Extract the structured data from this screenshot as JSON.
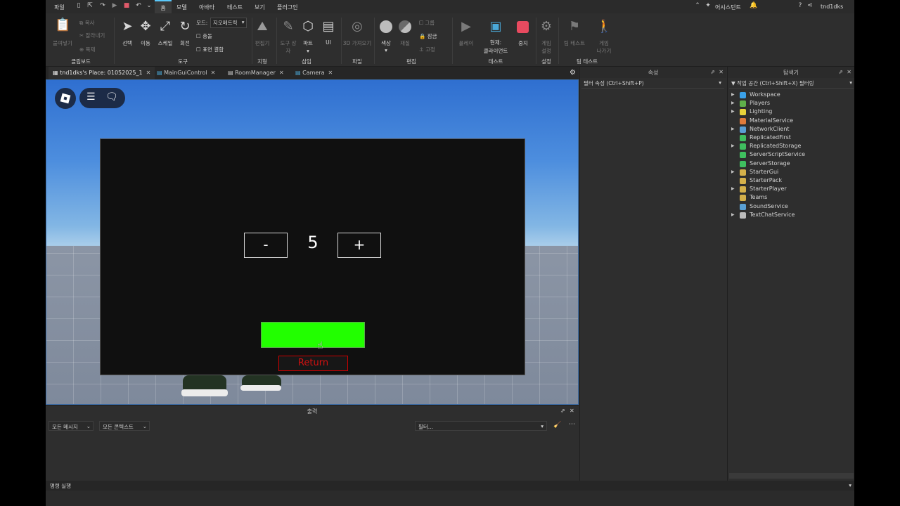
{
  "menubar": {
    "file": "파일",
    "home": "홈",
    "model": "모델",
    "avatar": "아바타",
    "test": "테스트",
    "view": "보기",
    "plugins": "플러그인",
    "assistant": "어시스턴트",
    "user": "tnd1dks"
  },
  "ribbon": {
    "clipboard": {
      "paste": "붙여넣기",
      "copy": "복사",
      "cut": "잘라내기",
      "duplicate": "복제",
      "group": "클립보드"
    },
    "tools": {
      "select": "선택",
      "move": "이동",
      "scale": "스케일",
      "rotate": "회전",
      "mode_label": "모드:",
      "mode_value": "지오메트릭",
      "collisions": "충돌",
      "join_surfaces": "표면 결합",
      "group": "도구"
    },
    "terrain": {
      "editor": "편집기",
      "group": "지형"
    },
    "insert": {
      "toolbox": "도구 상자",
      "part": "파트",
      "ui": "UI",
      "group": "삽입"
    },
    "file": {
      "import3d": "3D 가져오기",
      "group": "파일"
    },
    "edit": {
      "color": "색상",
      "material": "재질",
      "group_btn": "그룹",
      "lock": "잠금",
      "anchor": "고정",
      "group": "편집"
    },
    "test": {
      "play": "플레이",
      "current": "현재:",
      "client": "클라이언트",
      "stop": "중지",
      "group": "테스트"
    },
    "settings": {
      "game_settings": "게임 설정",
      "group": "설정"
    },
    "team_test": {
      "team_test": "팀 테스트",
      "exit_game": "게임 나가기",
      "group": "팀 테스트"
    }
  },
  "tabs": [
    {
      "label": "tnd1dks's Place: 01052025_1"
    },
    {
      "label": "MainGuiControl"
    },
    {
      "label": "RoomManager"
    },
    {
      "label": "Camera"
    }
  ],
  "game": {
    "minus": "-",
    "count": "5",
    "plus": "+",
    "return": "Return"
  },
  "output": {
    "title": "출력",
    "all_messages": "모든 메시지",
    "all_contexts": "모든 콘텍스트",
    "filter_placeholder": "필터..."
  },
  "command_bar": {
    "label": "명령 실행"
  },
  "properties": {
    "title": "속성",
    "filter": "필터 속성 (Ctrl+Shift+P)"
  },
  "explorer": {
    "title": "탐색기",
    "filter": "작업 공간 (Ctrl+Shift+X) 필터링",
    "items": [
      {
        "label": "Workspace",
        "color": "#3aa0e8",
        "expandable": true
      },
      {
        "label": "Players",
        "color": "#5fb04a",
        "expandable": true
      },
      {
        "label": "Lighting",
        "color": "#e8d23a",
        "expandable": true
      },
      {
        "label": "MaterialService",
        "color": "#e07b3a",
        "expandable": false
      },
      {
        "label": "NetworkClient",
        "color": "#5a9fd4",
        "expandable": true
      },
      {
        "label": "ReplicatedFirst",
        "color": "#3fbf5f",
        "expandable": false
      },
      {
        "label": "ReplicatedStorage",
        "color": "#3fbf5f",
        "expandable": true
      },
      {
        "label": "ServerScriptService",
        "color": "#3fbf5f",
        "expandable": false
      },
      {
        "label": "ServerStorage",
        "color": "#3fbf5f",
        "expandable": false
      },
      {
        "label": "StarterGui",
        "color": "#d4b04a",
        "expandable": true
      },
      {
        "label": "StarterPack",
        "color": "#d4b04a",
        "expandable": false
      },
      {
        "label": "StarterPlayer",
        "color": "#d4b04a",
        "expandable": true
      },
      {
        "label": "Teams",
        "color": "#d4b04a",
        "expandable": false
      },
      {
        "label": "SoundService",
        "color": "#5aa0d4",
        "expandable": false
      },
      {
        "label": "TextChatService",
        "color": "#bbbbbb",
        "expandable": true
      }
    ]
  }
}
